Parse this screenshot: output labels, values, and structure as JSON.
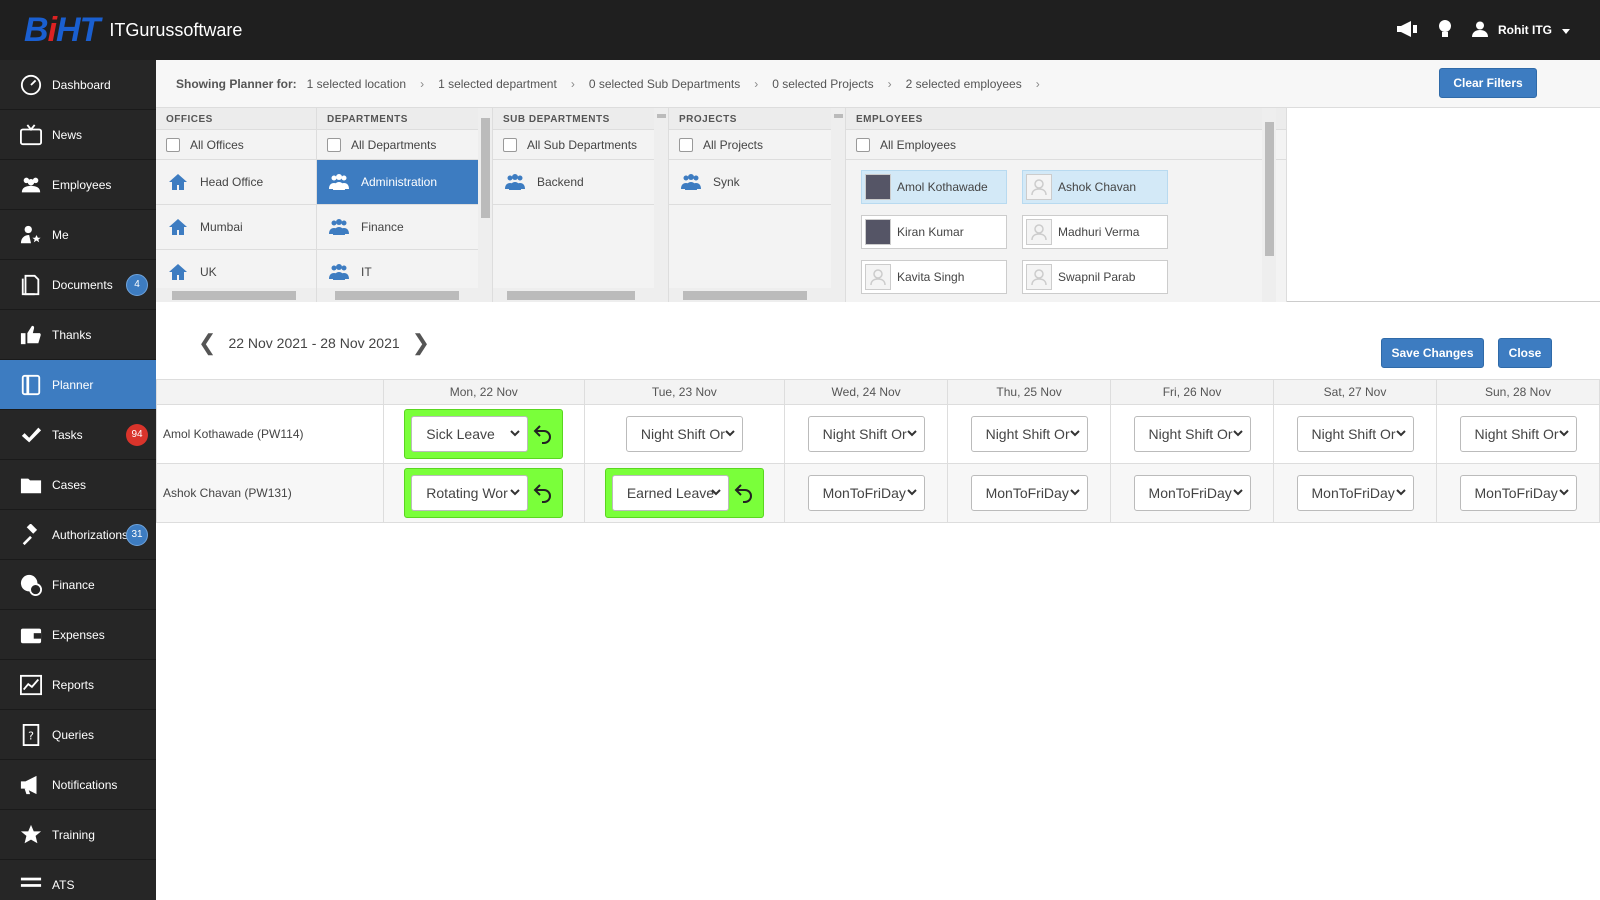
{
  "header": {
    "logo_text": "BiHT",
    "company_name": "ITGurussoftware",
    "user_name": "Rohit ITG"
  },
  "sidebar": {
    "items": [
      {
        "label": "Dashboard",
        "icon": "dashboard-icon"
      },
      {
        "label": "News",
        "icon": "tv-icon"
      },
      {
        "label": "Employees",
        "icon": "users-icon"
      },
      {
        "label": "Me",
        "icon": "user-star-icon"
      },
      {
        "label": "Documents",
        "icon": "documents-icon",
        "badge": "4"
      },
      {
        "label": "Thanks",
        "icon": "thumbs-up-icon"
      },
      {
        "label": "Planner",
        "icon": "planner-icon",
        "active": true
      },
      {
        "label": "Tasks",
        "icon": "check-icon",
        "badge": "94"
      },
      {
        "label": "Cases",
        "icon": "folder-icon"
      },
      {
        "label": "Authorizations",
        "icon": "gavel-icon",
        "badge": "31"
      },
      {
        "label": "Finance",
        "icon": "rupee-icon"
      },
      {
        "label": "Expenses",
        "icon": "wallet-icon"
      },
      {
        "label": "Reports",
        "icon": "chart-icon"
      },
      {
        "label": "Queries",
        "icon": "question-doc-icon"
      },
      {
        "label": "Notifications",
        "icon": "megaphone-icon"
      },
      {
        "label": "Training",
        "icon": "star-icon"
      },
      {
        "label": "ATS",
        "icon": "list-icon"
      }
    ]
  },
  "filterbar": {
    "label": "Showing Planner for:",
    "crumbs": [
      "1 selected location",
      "1 selected department",
      "0 selected Sub Departments",
      "0 selected Projects",
      "2 selected employees"
    ],
    "clear_label": "Clear Filters"
  },
  "panels": {
    "offices": {
      "title": "OFFICES",
      "all_label": "All Offices",
      "items": [
        "Head Office",
        "Mumbai",
        "UK"
      ]
    },
    "departments": {
      "title": "DEPARTMENTS",
      "all_label": "All Departments",
      "items": [
        "Administration",
        "Finance",
        "IT"
      ]
    },
    "subdepartments": {
      "title": "SUB DEPARTMENTS",
      "all_label": "All Sub Departments",
      "items": [
        "Backend"
      ]
    },
    "projects": {
      "title": "PROJECTS",
      "all_label": "All Projects",
      "items": [
        "Synk"
      ]
    },
    "employees": {
      "title": "EMPLOYEES",
      "all_label": "All Employees",
      "items": [
        "Amol Kothawade",
        "Ashok Chavan",
        "Kiran Kumar",
        "Madhuri Verma",
        "Kavita Singh",
        "Swapnil Parab"
      ]
    }
  },
  "planner": {
    "date_range": "22 Nov 2021 - 28 Nov 2021",
    "save_label": "Save Changes",
    "close_label": "Close",
    "days": [
      "Mon, 22 Nov",
      "Tue, 23 Nov",
      "Wed, 24 Nov",
      "Thu, 25 Nov",
      "Fri, 26 Nov",
      "Sat, 27 Nov",
      "Sun, 28 Nov"
    ],
    "rows": [
      {
        "name": "Amol Kothawade (PW114)",
        "cells": [
          "Sick Leave",
          "Night Shift Or",
          "Night Shift Or",
          "Night Shift Or",
          "Night Shift Or",
          "Night Shift Or",
          "Night Shift Or"
        ]
      },
      {
        "name": "Ashok Chavan (PW131)",
        "cells": [
          "Rotating Wor",
          "Earned Leave",
          "MonToFriDay",
          "MonToFriDay",
          "MonToFriDay",
          "MonToFriDay",
          "MonToFriDay"
        ]
      }
    ]
  },
  "colors": {
    "accent": "#3d7cc1",
    "changed": "#7aff3a",
    "topbar": "#1f1f1f",
    "sidebar": "#262626"
  }
}
